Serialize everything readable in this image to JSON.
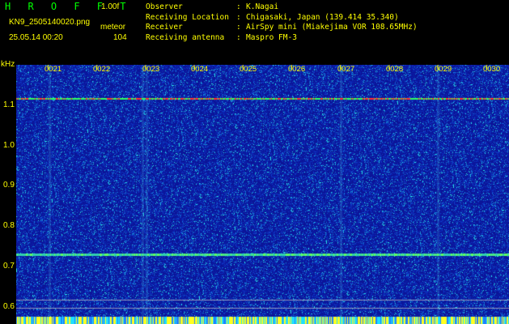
{
  "header": {
    "app_title": "H R O F F T",
    "version": "1.00f",
    "filename": "KN9_2505140020.png",
    "meteor_label": "meteor",
    "timestamp": "25.05.14 00:20",
    "count": "104"
  },
  "info": [
    {
      "key": "Observer",
      "value": "K.Nagai"
    },
    {
      "key": "Receiving Location",
      "value": "Chigasaki, Japan (139.414 35.340)"
    },
    {
      "key": "Receiver",
      "value": "AirSpy mini (Miakejima VOR 108.65MHz)"
    },
    {
      "key": "Receiving antenna",
      "value": "Maspro FM-3"
    }
  ],
  "axis": {
    "unit": "kHz",
    "y_ticks": [
      "1.1",
      "1.0",
      "0.9",
      "0.8",
      "0.7",
      "0.6"
    ],
    "time_ticks": [
      "0021",
      "0022",
      "0023",
      "0024",
      "0025",
      "0026",
      "0027",
      "0028",
      "0029",
      "0030"
    ]
  },
  "colors": {
    "label": "#ffff00",
    "title": "#00ff00",
    "background": "#1020a0"
  }
}
